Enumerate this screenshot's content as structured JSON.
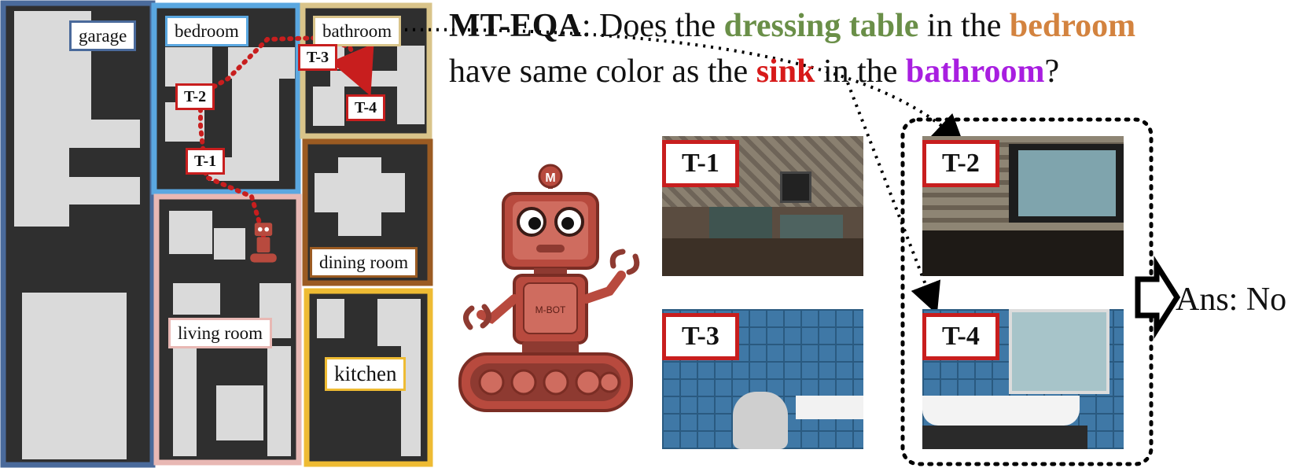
{
  "rooms": [
    {
      "id": "garage",
      "label": "garage",
      "color": "#4a6a9b"
    },
    {
      "id": "bedroom",
      "label": "bedroom",
      "color": "#5aa7e0"
    },
    {
      "id": "bathroom",
      "label": "bathroom",
      "color": "#d9c48a"
    },
    {
      "id": "dining",
      "label": "dining room",
      "color": "#9b5b22"
    },
    {
      "id": "living",
      "label": "living room",
      "color": "#e8b8b4"
    },
    {
      "id": "kitchen",
      "label": "kitchen",
      "color": "#eebb33"
    }
  ],
  "map_tags": [
    "T-1",
    "T-2",
    "T-3",
    "T-4"
  ],
  "question": {
    "prefix": "MT-EQA",
    "sep": ": Does the ",
    "obj1": "dressing table",
    "mid1": " in the ",
    "room1": "bedroom",
    "line2_a": "have same color as the ",
    "obj2": "sink",
    "mid2": " in the ",
    "room2": "bathroom",
    "end": "?"
  },
  "colors": {
    "dressing_table": "#6a8f48",
    "bedroom": "#d3833f",
    "sink": "#d71a1a",
    "bathroom": "#a81ee0"
  },
  "robot_badge": "M",
  "robot_chest": "M-BOT",
  "frames": [
    {
      "tag": "T-1",
      "scene": "living-room-view"
    },
    {
      "tag": "T-2",
      "scene": "bedroom-dresser-view"
    },
    {
      "tag": "T-3",
      "scene": "bathroom-toilet-view"
    },
    {
      "tag": "T-4",
      "scene": "bathroom-sink-view"
    }
  ],
  "answer": "Ans: No"
}
